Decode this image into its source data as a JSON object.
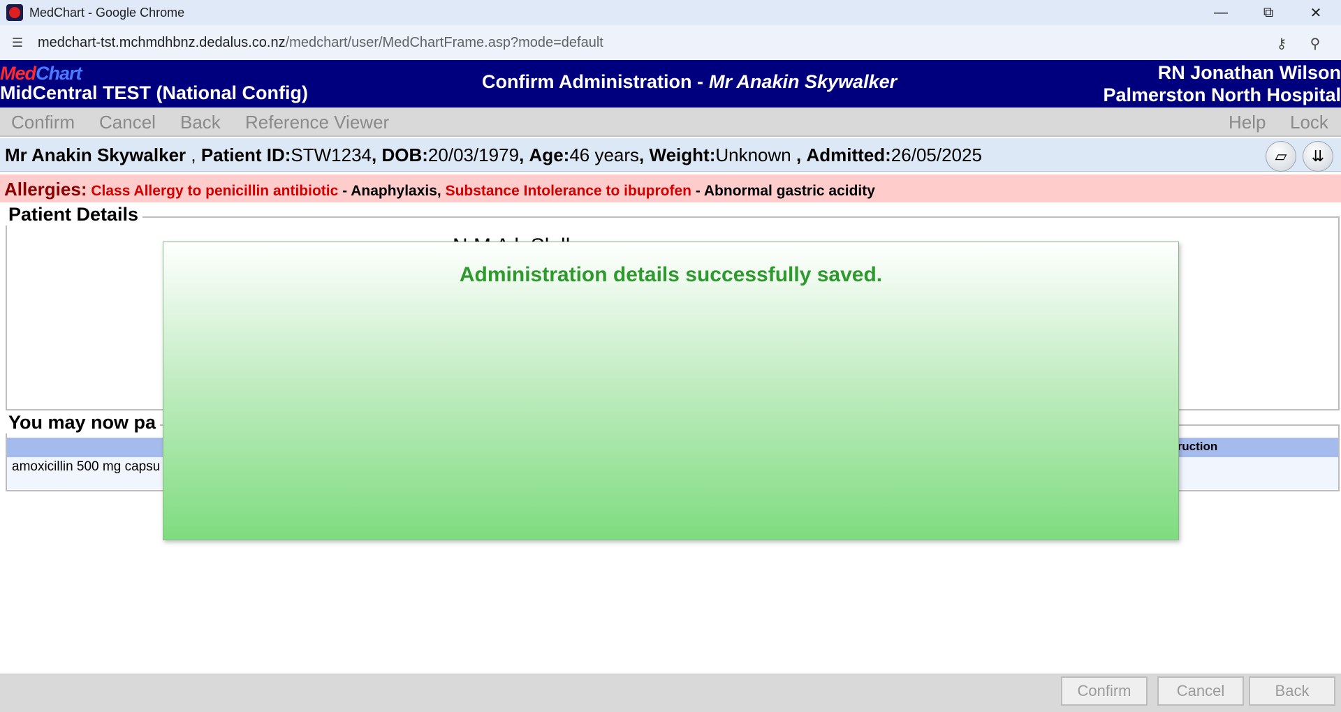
{
  "browser": {
    "window_title": "MedChart - Google Chrome",
    "url_host": "medchart-tst.mchmdhbnz.dedalus.co.nz",
    "url_path": "/medchart/user/MedChartFrame.asp?mode=default",
    "icons": [
      "site-info-icon",
      "password-key-icon",
      "zoom-icon",
      "minimize-icon",
      "restore-icon",
      "close-icon"
    ]
  },
  "header": {
    "logo_med": "Med",
    "logo_chart": "Chart",
    "site": "MidCentral TEST (National Config)",
    "screen_title": "Confirm Administration -",
    "patient_name": "Mr Anakin Skywalker",
    "user": "RN Jonathan Wilson",
    "hospital": "Palmerston North Hospital"
  },
  "menu": {
    "confirm": "Confirm",
    "cancel": "Cancel",
    "back": "Back",
    "reference_viewer": "Reference Viewer",
    "help": "Help",
    "lock": "Lock"
  },
  "patient": {
    "name": "Mr Anakin Skywalker",
    "id_label": "Patient ID:",
    "id": "STW1234",
    "dob_label": "DOB:",
    "dob": "20/03/1979",
    "age_label": "Age:",
    "age": "46 years",
    "weight_label": "Weight:",
    "weight": "Unknown",
    "admitted_label": "Admitted:",
    "admitted": "26/05/2025"
  },
  "allergies": {
    "label": "Allergies:",
    "items": [
      {
        "substance": "Class Allergy to penicillin antibiotic",
        "reaction": "Anaphylaxis"
      },
      {
        "substance": "Substance Intolerance to ibuprofen",
        "reaction": "Abnormal gastric acidity"
      }
    ]
  },
  "patient_details": {
    "legend": "Patient Details",
    "partial_text": "N          M A  k  Sk  lk"
  },
  "next_section": {
    "legend": "You may now pa",
    "column_partial": "truction",
    "row_drug_partial": "amoxicillin 500 mg capsu"
  },
  "modal": {
    "message": "Administration details successfully saved."
  },
  "footer": {
    "confirm": "Confirm",
    "cancel": "Cancel",
    "back": "Back"
  }
}
